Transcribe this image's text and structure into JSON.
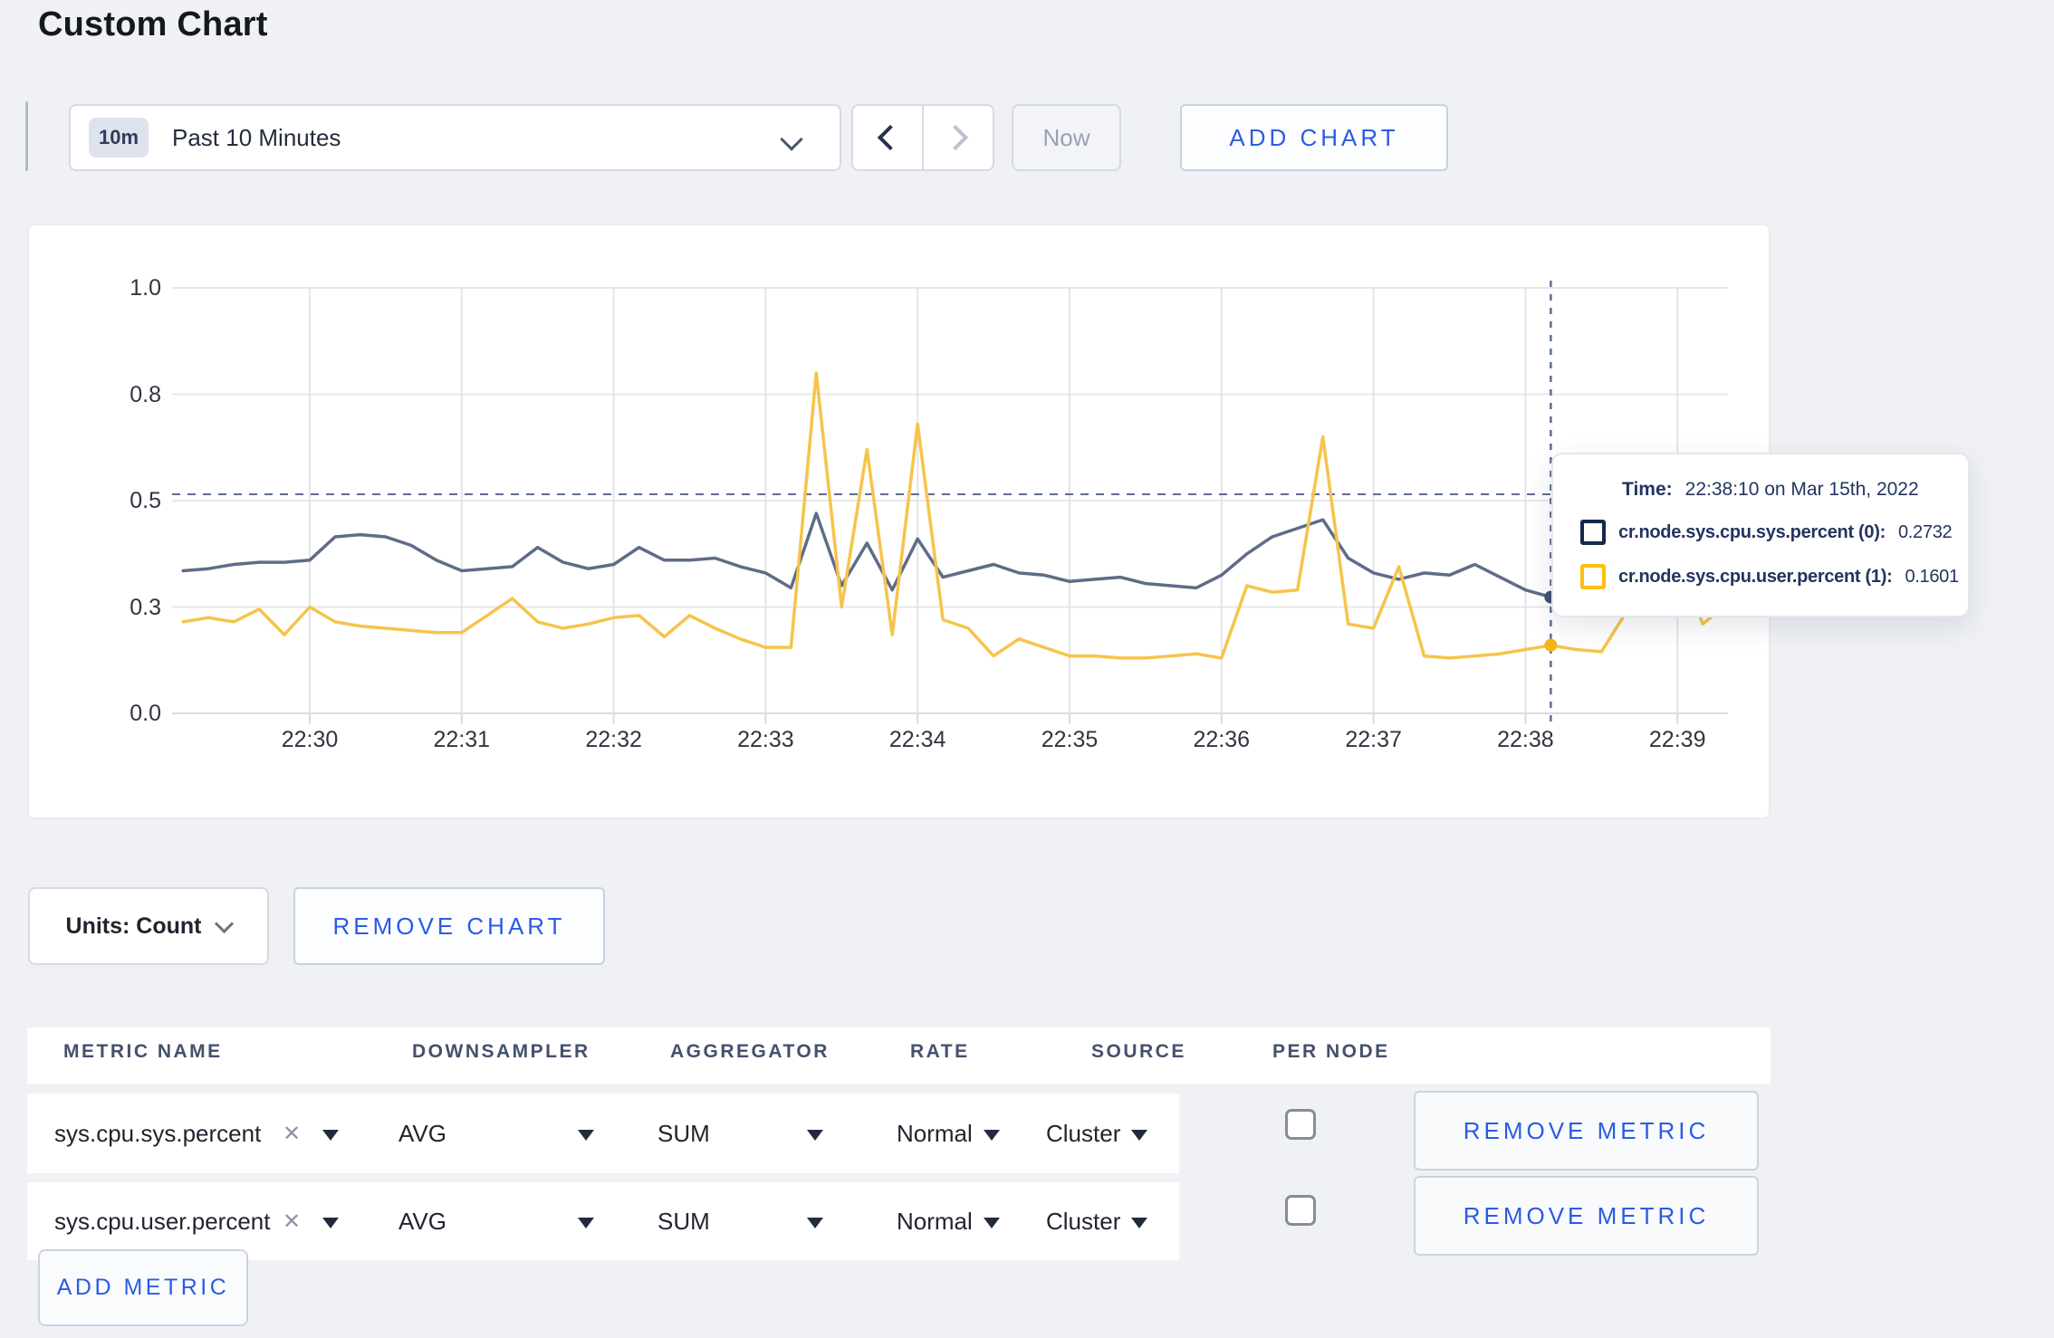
{
  "page": {
    "title": "Custom Chart"
  },
  "toolbar": {
    "time_window_badge": "10m",
    "time_window_label": "Past 10 Minutes",
    "now_label": "Now",
    "add_chart_label": "ADD CHART"
  },
  "chart_data": {
    "type": "line",
    "title": "",
    "x_ticks": [
      "22:30",
      "22:31",
      "22:32",
      "22:33",
      "22:34",
      "22:35",
      "22:36",
      "22:37",
      "22:38",
      "22:39"
    ],
    "x_start_time": "22:29:10",
    "x_interval_seconds": 10,
    "y_axis": {
      "labels": [
        "0.0",
        "0.3",
        "0.5",
        "0.8",
        "1.0"
      ],
      "values": [
        0,
        0.25,
        0.5,
        0.75,
        1.0
      ],
      "ylim": [
        0,
        1
      ]
    },
    "grid": true,
    "legend_position": "tooltip",
    "crosshair": {
      "time": "22:38:10",
      "x_index": 54,
      "hline_value": 0.515
    },
    "series": [
      {
        "name": "cr.node.sys.cpu.sys.percent",
        "color": "#5f6c87",
        "dot_color": "#42526e",
        "values": [
          0.335,
          0.34,
          0.35,
          0.355,
          0.355,
          0.36,
          0.415,
          0.42,
          0.415,
          0.395,
          0.36,
          0.335,
          0.34,
          0.345,
          0.39,
          0.355,
          0.34,
          0.35,
          0.39,
          0.36,
          0.36,
          0.365,
          0.345,
          0.33,
          0.295,
          0.47,
          0.3,
          0.4,
          0.29,
          0.41,
          0.32,
          0.335,
          0.35,
          0.33,
          0.325,
          0.31,
          0.315,
          0.32,
          0.305,
          0.3,
          0.295,
          0.325,
          0.375,
          0.415,
          0.435,
          0.455,
          0.365,
          0.33,
          0.315,
          0.33,
          0.325,
          0.35,
          0.32,
          0.29,
          0.2732,
          0.29,
          0.3,
          0.29,
          0.285,
          0.29,
          0.3,
          0.295
        ]
      },
      {
        "name": "cr.node.sys.cpu.user.percent",
        "color": "#f6c44b",
        "dot_color": "#f3b415",
        "values": [
          0.215,
          0.225,
          0.215,
          0.245,
          0.185,
          0.25,
          0.215,
          0.205,
          0.2,
          0.195,
          0.19,
          0.19,
          0.23,
          0.27,
          0.215,
          0.2,
          0.21,
          0.225,
          0.23,
          0.18,
          0.23,
          0.2,
          0.175,
          0.155,
          0.155,
          0.8,
          0.25,
          0.62,
          0.185,
          0.68,
          0.22,
          0.2,
          0.135,
          0.175,
          0.155,
          0.135,
          0.135,
          0.13,
          0.13,
          0.135,
          0.14,
          0.13,
          0.3,
          0.285,
          0.29,
          0.65,
          0.21,
          0.2,
          0.345,
          0.135,
          0.13,
          0.135,
          0.14,
          0.15,
          0.1601,
          0.15,
          0.145,
          0.24,
          0.375,
          0.36,
          0.21,
          0.26
        ]
      }
    ]
  },
  "tooltip": {
    "time_label": "Time:",
    "time_value": "22:38:10 on Mar 15th, 2022",
    "entries": [
      {
        "label": "cr.node.sys.cpu.sys.percent (0):",
        "value": "0.2732",
        "swatch_color": "#16274d"
      },
      {
        "label": "cr.node.sys.cpu.user.percent (1):",
        "value": "0.1601",
        "swatch_color": "#fdc10a"
      }
    ]
  },
  "chart_controls": {
    "units_label": "Units: Count",
    "remove_chart_label": "REMOVE CHART"
  },
  "metrics_table": {
    "headers": [
      "METRIC NAME",
      "DOWNSAMPLER",
      "AGGREGATOR",
      "RATE",
      "SOURCE",
      "PER NODE"
    ],
    "rows": [
      {
        "metric_name": "sys.cpu.sys.percent",
        "downsampler": "AVG",
        "aggregator": "SUM",
        "rate": "Normal",
        "source": "Cluster",
        "per_node_checked": false,
        "remove_label": "REMOVE METRIC"
      },
      {
        "metric_name": "sys.cpu.user.percent",
        "downsampler": "AVG",
        "aggregator": "SUM",
        "rate": "Normal",
        "source": "Cluster",
        "per_node_checked": false,
        "remove_label": "REMOVE METRIC"
      }
    ],
    "add_metric_label": "ADD METRIC"
  },
  "colors": {
    "accent_blue": "#2b5be4",
    "page_background": "#eff1f4",
    "series_sys": "#5f6c87",
    "series_user": "#f6c44b",
    "crosshair": "#5b6e92"
  }
}
